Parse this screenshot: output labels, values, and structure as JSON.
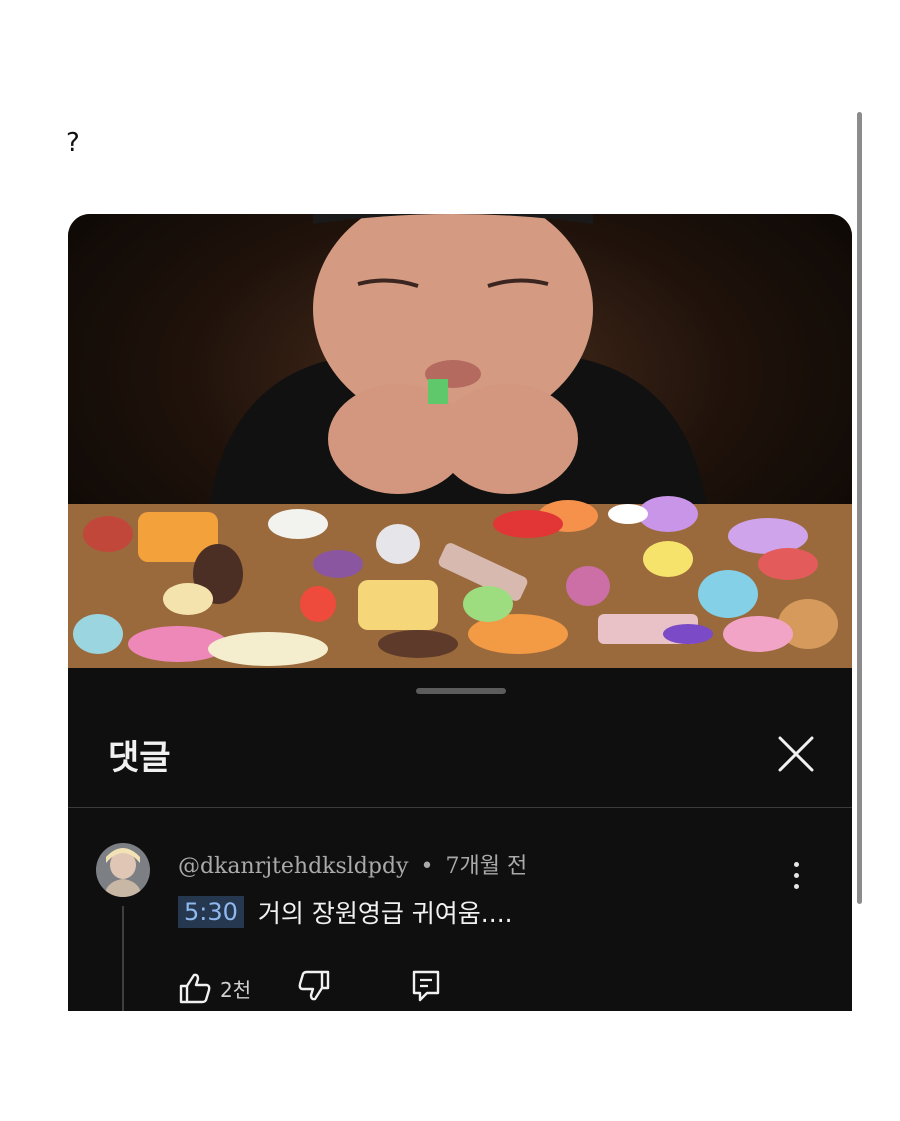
{
  "post": {
    "text": "?"
  },
  "sheet": {
    "title": "댓글"
  },
  "comment": {
    "author": "@dkanrjtehdksldpdy",
    "separator": "•",
    "time": "7개월 전",
    "timestamp_link": "5:30",
    "text": "거의 장원영급 귀여움....",
    "like_count": "2천"
  },
  "colors": {
    "background": "#0f0f0f",
    "text": "#f1f1f1",
    "meta_text": "#aaaaaa",
    "timestamp_link": "#8fb8ee"
  },
  "icons": [
    "close-icon",
    "more-vert-icon",
    "thumbs-up-icon",
    "thumbs-down-icon",
    "reply-comment-icon"
  ]
}
